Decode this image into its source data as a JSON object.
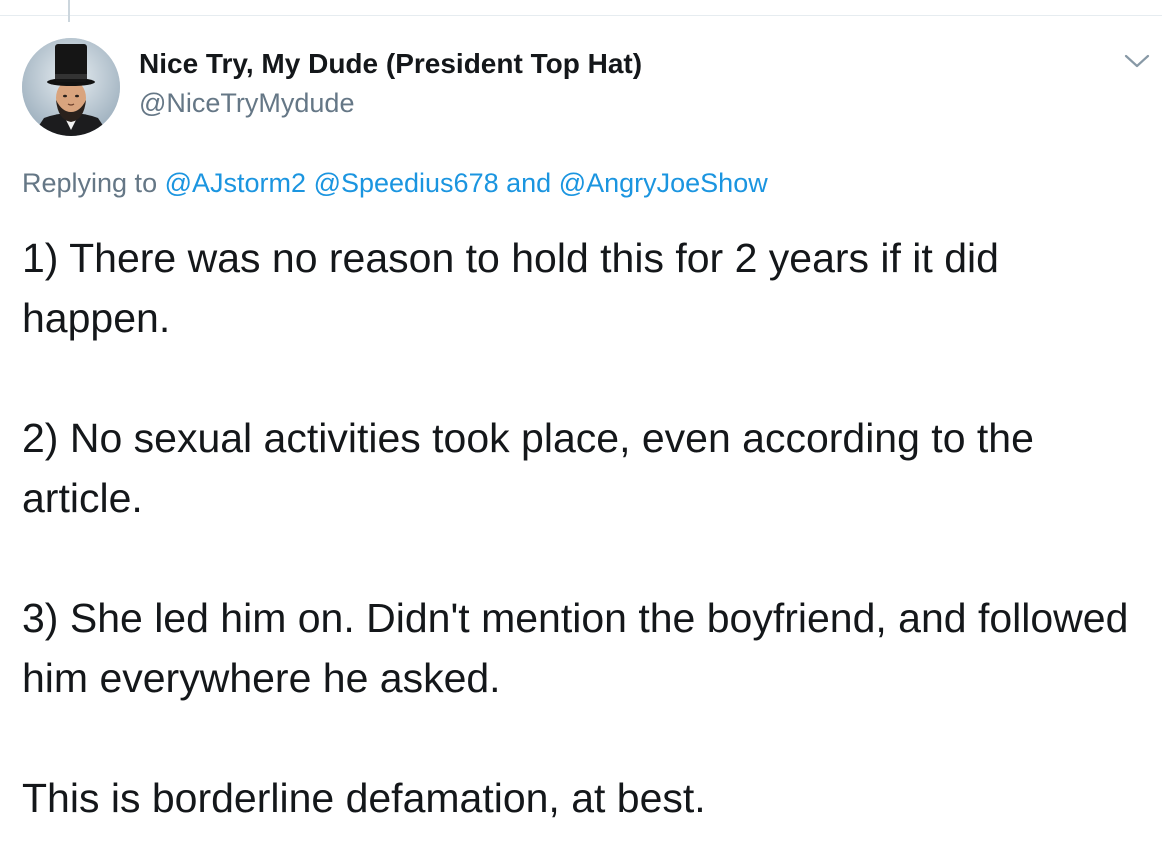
{
  "tweet": {
    "author": {
      "display_name": "Nice Try, My Dude (President Top Hat)",
      "handle": "@NiceTryMydude"
    },
    "reply": {
      "prefix": "Replying to",
      "mentions": [
        "@AJstorm2",
        "@Speedius678",
        "@AngryJoeShow"
      ],
      "conjunction": "and"
    },
    "paragraphs": [
      "1) There was no reason to hold this for 2 years if it did happen.",
      "2) No sexual activities took place, even according to the article.",
      "3) She led him on. Didn't mention the boyfriend, and followed him everywhere he asked.",
      "This is borderline defamation, at best."
    ],
    "menu_icon": "chevron-down-icon"
  },
  "colors": {
    "text_primary": "#14171a",
    "text_secondary": "#657786",
    "link": "#1b95e0",
    "divider": "#e6ecf0"
  }
}
